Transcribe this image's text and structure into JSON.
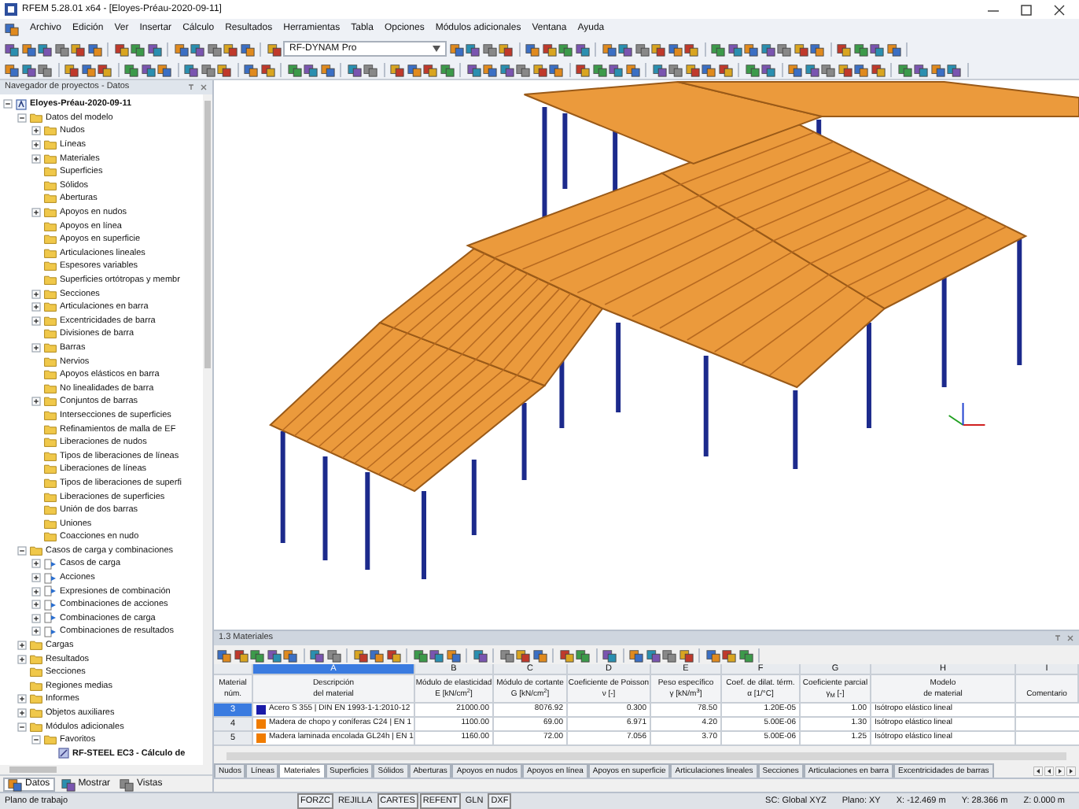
{
  "window": {
    "title": "RFEM 5.28.01 x64 - [Eloyes-Préau-2020-09-11]"
  },
  "menu": [
    "Archivo",
    "Edición",
    "Ver",
    "Insertar",
    "Cálculo",
    "Resultados",
    "Herramientas",
    "Tabla",
    "Opciones",
    "Módulos adicionales",
    "Ventana",
    "Ayuda"
  ],
  "toolbar": {
    "module_select": "RF-DYNAM Pro"
  },
  "navigator": {
    "title": "Navegador de proyectos - Datos",
    "tree": [
      {
        "label": "Eloyes-Préau-2020-09-11",
        "kind": "project",
        "expanded": true,
        "children": [
          {
            "label": "Datos del modelo",
            "kind": "folder",
            "expanded": true,
            "children": [
              {
                "label": "Nudos",
                "kind": "folder",
                "expanded": false
              },
              {
                "label": "Líneas",
                "kind": "folder",
                "expanded": false
              },
              {
                "label": "Materiales",
                "kind": "folder",
                "expanded": false
              },
              {
                "label": "Superficies",
                "kind": "folder"
              },
              {
                "label": "Sólidos",
                "kind": "folder"
              },
              {
                "label": "Aberturas",
                "kind": "folder"
              },
              {
                "label": "Apoyos en nudos",
                "kind": "folder",
                "expanded": false
              },
              {
                "label": "Apoyos en línea",
                "kind": "folder"
              },
              {
                "label": "Apoyos en superficie",
                "kind": "folder"
              },
              {
                "label": "Articulaciones lineales",
                "kind": "folder"
              },
              {
                "label": "Espesores variables",
                "kind": "folder"
              },
              {
                "label": "Superficies ortótropas y membr",
                "kind": "folder"
              },
              {
                "label": "Secciones",
                "kind": "folder",
                "expanded": false
              },
              {
                "label": "Articulaciones en barra",
                "kind": "folder",
                "expanded": false
              },
              {
                "label": "Excentricidades de barra",
                "kind": "folder",
                "expanded": false
              },
              {
                "label": "Divisiones de barra",
                "kind": "folder"
              },
              {
                "label": "Barras",
                "kind": "folder",
                "expanded": false
              },
              {
                "label": "Nervios",
                "kind": "folder"
              },
              {
                "label": "Apoyos elásticos en barra",
                "kind": "folder"
              },
              {
                "label": "No linealidades de barra",
                "kind": "folder"
              },
              {
                "label": "Conjuntos de barras",
                "kind": "folder",
                "expanded": false
              },
              {
                "label": "Intersecciones de superficies",
                "kind": "folder"
              },
              {
                "label": "Refinamientos de malla de EF",
                "kind": "folder"
              },
              {
                "label": "Liberaciones de nudos",
                "kind": "folder"
              },
              {
                "label": "Tipos de liberaciones de líneas",
                "kind": "folder"
              },
              {
                "label": "Liberaciones de líneas",
                "kind": "folder"
              },
              {
                "label": "Tipos de liberaciones de superfi",
                "kind": "folder"
              },
              {
                "label": "Liberaciones de superficies",
                "kind": "folder"
              },
              {
                "label": "Unión de dos barras",
                "kind": "folder"
              },
              {
                "label": "Uniones",
                "kind": "folder"
              },
              {
                "label": "Coacciones en nudo",
                "kind": "folder"
              }
            ]
          },
          {
            "label": "Casos de carga y combinaciones",
            "kind": "folder",
            "expanded": true,
            "children": [
              {
                "label": "Casos de carga",
                "kind": "item",
                "expanded": false
              },
              {
                "label": "Acciones",
                "kind": "item",
                "expanded": false
              },
              {
                "label": "Expresiones de combinación",
                "kind": "item",
                "expanded": false
              },
              {
                "label": "Combinaciones de acciones",
                "kind": "item",
                "expanded": false
              },
              {
                "label": "Combinaciones de carga",
                "kind": "item",
                "expanded": false
              },
              {
                "label": "Combinaciones de resultados",
                "kind": "item",
                "expanded": false
              }
            ]
          },
          {
            "label": "Cargas",
            "kind": "folder",
            "expanded": false
          },
          {
            "label": "Resultados",
            "kind": "folder",
            "expanded": false
          },
          {
            "label": "Secciones",
            "kind": "folder"
          },
          {
            "label": "Regiones medias",
            "kind": "folder"
          },
          {
            "label": "Informes",
            "kind": "folder",
            "expanded": false
          },
          {
            "label": "Objetos auxiliares",
            "kind": "folder",
            "expanded": false
          },
          {
            "label": "Módulos adicionales",
            "kind": "folder",
            "expanded": true,
            "children": [
              {
                "label": "Favoritos",
                "kind": "folder",
                "expanded": true,
                "children": [
                  {
                    "label": "RF-STEEL EC3 - Cálculo de",
                    "kind": "module"
                  }
                ]
              }
            ]
          }
        ]
      }
    ],
    "tabs": [
      {
        "label": "Datos",
        "selected": true
      },
      {
        "label": "Mostrar",
        "selected": false
      },
      {
        "label": "Vistas",
        "selected": false
      }
    ]
  },
  "table_panel": {
    "title": "1.3 Materiales",
    "columns": [
      {
        "line1": "Material",
        "line2": "núm.",
        "selected": false
      },
      {
        "letter": "A",
        "line1": "Descripción",
        "line2": "del material",
        "selected": true
      },
      {
        "letter": "B",
        "line1": "Módulo de elasticidad",
        "line2": "E [kN/cm$^{2}$]",
        "selected": false
      },
      {
        "letter": "C",
        "line1": "Módulo de cortante",
        "line2": "G [kN/cm$^{2}$]",
        "selected": false
      },
      {
        "letter": "D",
        "line1": "Coeficiente de Poisson",
        "line2": "ν [-]",
        "selected": false
      },
      {
        "letter": "E",
        "line1": "Peso específico",
        "line2": "γ [kN/m$^{3}$]",
        "selected": false
      },
      {
        "letter": "F",
        "line1": "Coef. de dilat. térm.",
        "line2": "α [1/°C]",
        "selected": false
      },
      {
        "letter": "G",
        "line1": "Coeficiente parcial",
        "line2": "γ$_{M}$ [-]",
        "selected": false
      },
      {
        "letter": "H",
        "line1": "Modelo",
        "line2": "de material",
        "selected": false
      },
      {
        "letter": "I",
        "line1": "Comentario",
        "selected": false
      }
    ],
    "rows": [
      {
        "selected": true,
        "color": "#1a1aa8",
        "cells": [
          "3",
          "Acero S 355 | DIN EN 1993-1-1:2010-12",
          "21000.00",
          "8076.92",
          "0.300",
          "78.50",
          "1.20E-05",
          "1.00",
          "Isótropo elástico lineal"
        ]
      },
      {
        "selected": false,
        "color": "#f07c00",
        "cells": [
          "4",
          "Madera de chopo y coníferas C24 | EN 1",
          "1100.00",
          "69.00",
          "6.971",
          "4.20",
          "5.00E-06",
          "1.30",
          "Isótropo elástico lineal"
        ]
      },
      {
        "selected": false,
        "color": "#f07c00",
        "cells": [
          "5",
          "Madera laminada encolada GL24h | EN 1",
          "1160.00",
          "72.00",
          "7.056",
          "3.70",
          "5.00E-06",
          "1.25",
          "Isótropo elástico lineal"
        ]
      }
    ],
    "tabs": [
      {
        "label": "Nudos",
        "selected": false
      },
      {
        "label": "Líneas",
        "selected": false
      },
      {
        "label": "Materiales",
        "selected": true
      },
      {
        "label": "Superficies",
        "selected": false
      },
      {
        "label": "Sólidos",
        "selected": false
      },
      {
        "label": "Aberturas",
        "selected": false
      },
      {
        "label": "Apoyos en nudos",
        "selected": false
      },
      {
        "label": "Apoyos en línea",
        "selected": false
      },
      {
        "label": "Apoyos en superficie",
        "selected": false
      },
      {
        "label": "Articulaciones lineales",
        "selected": false
      },
      {
        "label": "Secciones",
        "selected": false
      },
      {
        "label": "Articulaciones en barra",
        "selected": false
      },
      {
        "label": "Excentricidades de barras",
        "selected": false
      }
    ]
  },
  "status_bar": {
    "left": "Plano de trabajo",
    "toggles": [
      {
        "label": "FORZC",
        "on": true
      },
      {
        "label": "REJILLA",
        "on": false
      },
      {
        "label": "CARTES",
        "on": true
      },
      {
        "label": "REFENT",
        "on": true
      },
      {
        "label": "GLN",
        "on": false
      },
      {
        "label": "DXF",
        "on": true
      }
    ],
    "coords": [
      "SC: Global XYZ",
      "Plano: XY",
      "X: -12.469 m",
      "Y: 28.366 m",
      "Z: 0.000 m"
    ]
  }
}
